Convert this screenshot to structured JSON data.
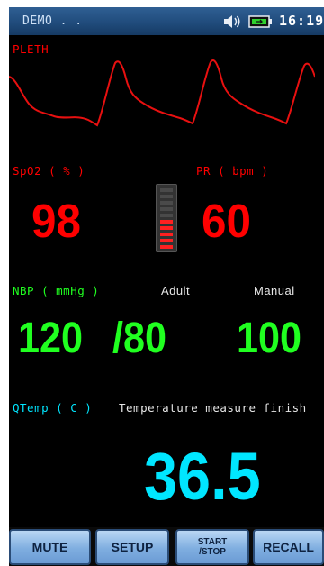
{
  "status": {
    "demo_label": "DEMO . .",
    "time": "16:19",
    "icons": [
      "speaker-icon",
      "battery-icon"
    ]
  },
  "pleth": {
    "label": "PLETH"
  },
  "spo2": {
    "label": "SpO2 ( % )",
    "value": "98"
  },
  "pr": {
    "label": "PR ( bpm )",
    "value": "60"
  },
  "signal_bar": {
    "segments_total": 10,
    "segments_lit": 5
  },
  "nbp": {
    "label": "NBP ( mmHg )",
    "mode": "Adult",
    "measure": "Manual",
    "systolic": "120",
    "diastolic": "/80",
    "mean": "100"
  },
  "temp": {
    "label": "QTemp ( C )",
    "message": "Temperature measure finish",
    "value": "36.5"
  },
  "buttons": [
    {
      "id": "mute",
      "label": "MUTE"
    },
    {
      "id": "setup",
      "label": "SETUP"
    },
    {
      "id": "startstop",
      "label": "START /STOP"
    },
    {
      "id": "recall",
      "label": "RECALL"
    }
  ],
  "colors": {
    "pleth": "#ff0000",
    "spo2": "#ff0000",
    "nbp": "#20ff20",
    "temp": "#00e6ff",
    "statusbar": "#1f4a7a",
    "button": "#8bb6e4"
  }
}
